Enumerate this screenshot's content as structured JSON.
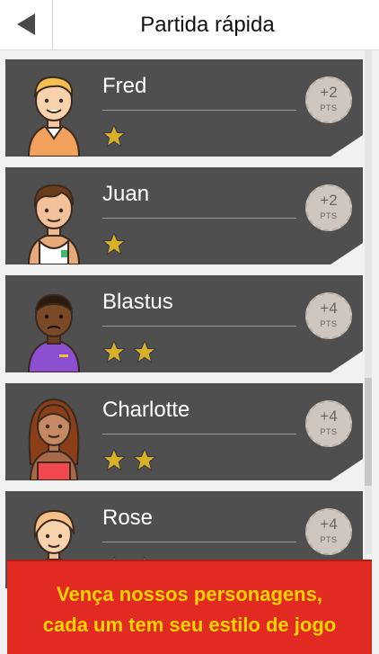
{
  "header": {
    "title": "Partida rápida"
  },
  "opponents": [
    {
      "name": "Fred",
      "stars": 1,
      "points": "+2",
      "points_unit": "PTS"
    },
    {
      "name": "Juan",
      "stars": 1,
      "points": "+2",
      "points_unit": "PTS"
    },
    {
      "name": "Blastus",
      "stars": 2,
      "points": "+4",
      "points_unit": "PTS"
    },
    {
      "name": "Charlotte",
      "stars": 2,
      "points": "+4",
      "points_unit": "PTS"
    },
    {
      "name": "Rose",
      "stars": 2,
      "points": "+4",
      "points_unit": "PTS"
    }
  ],
  "banner": {
    "line1": "Vença nossos personagens,",
    "line2": "cada um tem seu estilo de jogo"
  },
  "colors": {
    "card": "#4f4f4f",
    "star": "#d8b12a",
    "banner": "#e02a22",
    "banner_text": "#ffd400"
  }
}
